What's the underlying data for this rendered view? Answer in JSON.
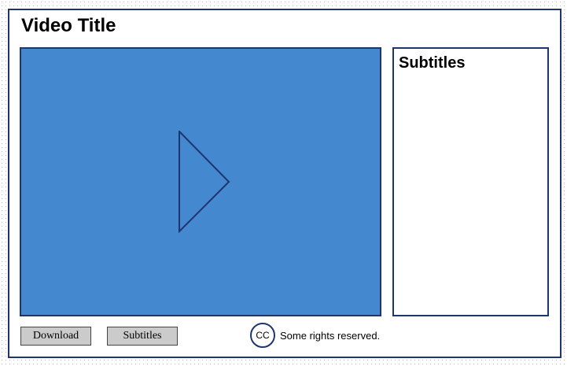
{
  "header": {
    "title": "Video Title"
  },
  "player": {
    "play_icon": "play-triangle-icon",
    "background_color": "#4489cf",
    "border_color": "#1f3570"
  },
  "subtitles_panel": {
    "heading": "Subtitles"
  },
  "controls": {
    "download_label": "Download",
    "subtitles_label": "Subtitles"
  },
  "license": {
    "icon_label": "CC",
    "icon": "creative-commons-icon",
    "text": "Some rights reserved."
  }
}
